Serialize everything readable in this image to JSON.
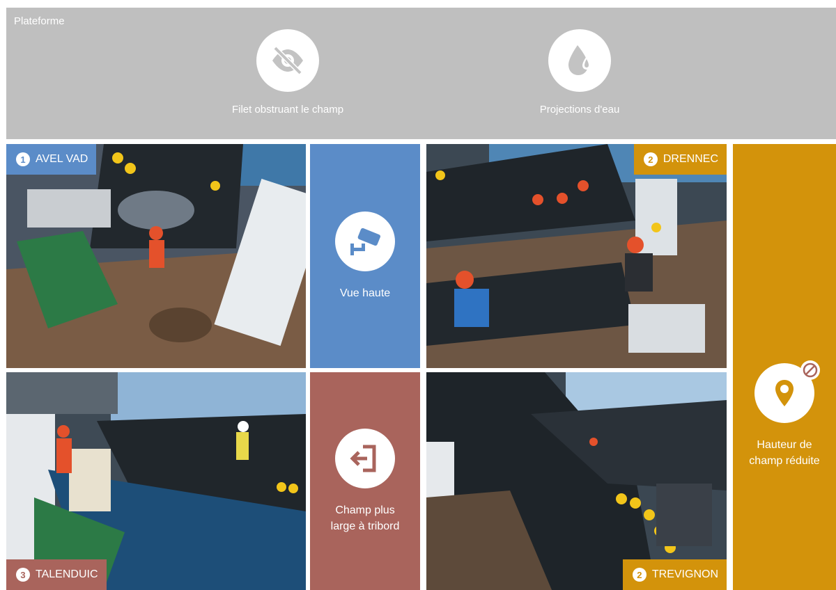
{
  "platform": {
    "title": "Plateforme",
    "hazards": [
      {
        "label": "Filet obstruant le champ",
        "icon": "eye-slash-icon"
      },
      {
        "label": "Projections d'eau",
        "icon": "water-drop-icon"
      }
    ]
  },
  "cameras": [
    {
      "num": "1",
      "name": "AVEL VAD",
      "color": "#5b8cc8"
    },
    {
      "num": "2",
      "name": "DRENNEC",
      "color": "#d3930b"
    },
    {
      "num": "3",
      "name": "TALENDUIC",
      "color": "#a9645c"
    },
    {
      "num": "2",
      "name": "TREVIGNON",
      "color": "#d3930b"
    }
  ],
  "tiles": {
    "top_view": {
      "label": "Vue haute",
      "icon": "security-camera-icon",
      "color": "#5b8cc8"
    },
    "starboard": {
      "label_1": "Champ plus",
      "label_2": "large à tribord",
      "icon": "exit-door-icon",
      "color": "#a9645c"
    },
    "height": {
      "label_1": "Hauteur de",
      "label_2": "champ réduite",
      "icon": "location-pin-icon",
      "badge": "no-entry-icon",
      "color": "#d3930b"
    }
  }
}
